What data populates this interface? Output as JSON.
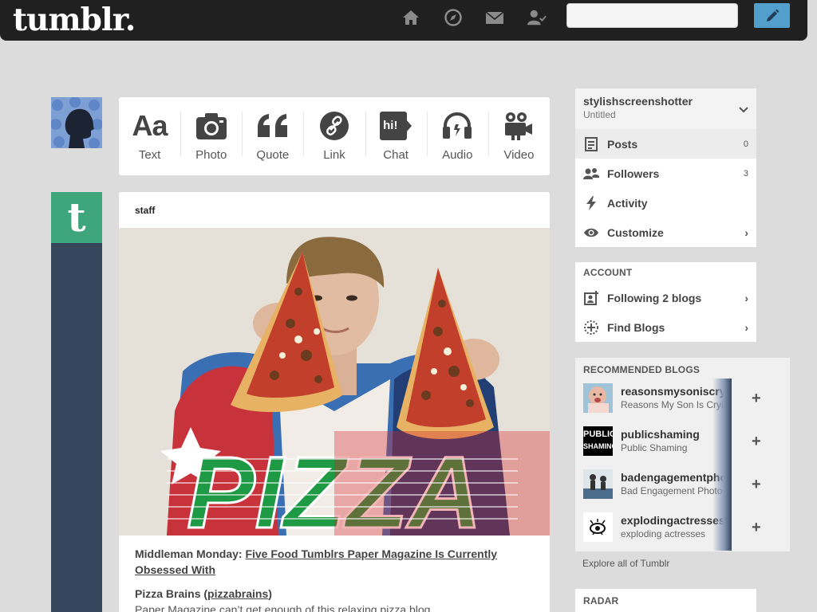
{
  "header": {
    "logo": "tumblr.",
    "nav_icons": [
      "home-icon",
      "compass-icon",
      "mail-icon",
      "account-icon"
    ],
    "search_placeholder": "",
    "compose_icon": "pencil-icon"
  },
  "post_types": [
    {
      "label": "Text",
      "icon": "text-icon"
    },
    {
      "label": "Photo",
      "icon": "camera-icon"
    },
    {
      "label": "Quote",
      "icon": "quote-icon"
    },
    {
      "label": "Link",
      "icon": "link-icon"
    },
    {
      "label": "Chat",
      "icon": "chat-icon"
    },
    {
      "label": "Audio",
      "icon": "headphones-icon"
    },
    {
      "label": "Video",
      "icon": "video-camera-icon"
    }
  ],
  "post_type_glyphs": {
    "text": "Aa",
    "chat": "hi!"
  },
  "post": {
    "author": "staff",
    "author_avatar_letter": "t",
    "image_word": "PIZZA",
    "body_prefix": "Middleman Monday: ",
    "body_link": "Five Food Tumblrs Paper Magazine Is Currently Obsessed With",
    "section_title": "Pizza Brains (",
    "section_link": "pizzabrains",
    "section_close": ")",
    "section_text": "Paper Magazine can’t get enough of this relaxing pizza blog."
  },
  "sidebar": {
    "blog_name": "stylishscreenshotter",
    "blog_subtitle": "Untitled",
    "menu": [
      {
        "label": "Posts",
        "count": "0",
        "icon": "posts-icon"
      },
      {
        "label": "Followers",
        "count": "3",
        "icon": "followers-icon"
      },
      {
        "label": "Activity",
        "icon": "lightning-icon"
      },
      {
        "label": "Customize",
        "chevron": "›",
        "icon": "eye-icon"
      }
    ],
    "account_title": "ACCOUNT",
    "account_items": [
      {
        "label": "Following 2 blogs",
        "chevron": "›",
        "icon": "following-icon"
      },
      {
        "label": "Find Blogs",
        "chevron": "›",
        "icon": "find-blogs-icon"
      }
    ],
    "recommended_title": "RECOMMENDED BLOGS",
    "recommended": [
      {
        "name": "reasonsmysoniscrying",
        "subtitle": "Reasons My Son Is Crying",
        "plus": "+"
      },
      {
        "name": "publicshaming",
        "subtitle": "Public Shaming",
        "plus": "+",
        "thumb_text": [
          "PUBLIC",
          "SHAMING"
        ]
      },
      {
        "name": "badengagementphotos",
        "subtitle": "Bad Engagement Photos",
        "plus": "+"
      },
      {
        "name": "explodingactresses",
        "subtitle": "exploding actresses",
        "plus": "+"
      }
    ],
    "explore": "Explore all of Tumblr",
    "radar_title": "RADAR"
  },
  "colors": {
    "topbar": "#202020",
    "background": "#dcdcdc",
    "compose": "#529ecc",
    "staff_green": "#3ea57d",
    "dashboard_navy": "#36465d"
  }
}
